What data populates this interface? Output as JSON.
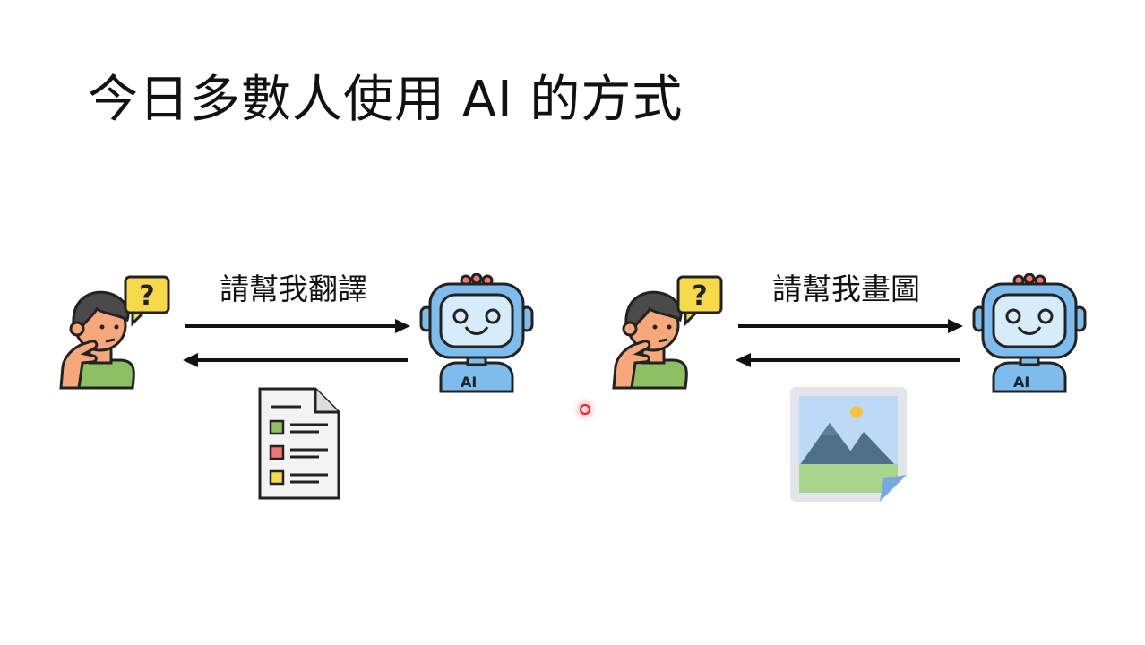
{
  "title": "今日多數人使用 AI 的方式",
  "examples": [
    {
      "request": "請幫我翻譯",
      "user_icon": "thinking-person-icon",
      "ai_icon": "robot-ai-icon",
      "ai_badge": "AI",
      "response_icon": "document-icon"
    },
    {
      "request": "請幫我畫圖",
      "user_icon": "thinking-person-icon",
      "ai_icon": "robot-ai-icon",
      "ai_badge": "AI",
      "response_icon": "image-icon"
    }
  ],
  "colors": {
    "skin": "#f7a77c",
    "hair": "#4a4a4a",
    "shirt": "#8cc063",
    "question_bubble": "#f7d94c",
    "robot_body": "#7dbcec",
    "robot_screen": "#d7ecfa",
    "robot_antenna": "#f0766f",
    "arrow": "#111111"
  }
}
